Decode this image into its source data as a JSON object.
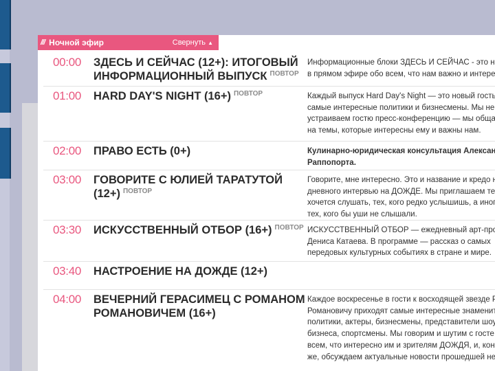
{
  "tab": {
    "icon": "///",
    "title": "Ночной эфир",
    "collapse_label": "Свернуть",
    "collapse_arrow": "▲"
  },
  "repeat_label": "ПОВТОР",
  "schedule": [
    {
      "time": "00:00",
      "title": "ЗДЕСЬ И СЕЙЧАС (12+): ИТОГОВЫЙ ИНФОРМАЦИОННЫЙ ВЫПУСК",
      "repeat": true,
      "desc_bold": false,
      "desc": [
        "Информационные блоки ЗДЕСЬ И СЕЙЧАС - это но",
        "в прямом эфире обо всем, что нам важно и интерес"
      ]
    },
    {
      "time": "01:00",
      "title": "HARD DAY'S NIGHT (16+)",
      "repeat": true,
      "desc_bold": false,
      "desc": [
        " Каждый выпуск Hard Day's Night — это новый гость",
        "самые интересные политики и бизнесмены. Мы не т",
        "устраиваем гостю пресс-конференцию — мы общае",
        "на темы, которые интересны ему и важны нам."
      ]
    },
    {
      "time": "02:00",
      "title": "ПРАВО ЕСТЬ (0+)",
      "repeat": false,
      "desc_bold": true,
      "desc": [
        "Кулинарно-юридическая консультация Алексан",
        "Раппопорта."
      ]
    },
    {
      "time": "03:00",
      "title": "ГОВОРИТЕ С ЮЛИЕЙ ТАРАТУТОЙ (12+)",
      "repeat": true,
      "desc_bold": false,
      "desc": [
        "Говорите, мне интересно. Это и название и кредо н",
        "дневного интервью на ДОЖДЕ. Мы приглашаем тех",
        "хочется слушать, тех, кого редко услышишь, а иногд",
        "тех, кого бы уши не слышали."
      ]
    },
    {
      "time": "03:30",
      "title": "ИСКУССТВЕННЫЙ ОТБОР (16+)",
      "repeat": true,
      "desc_bold": false,
      "desc": [
        "ИСКУССТВЕННЫЙ ОТБОР — ежедневный арт-про",
        "Дениса Катаева. В программе — рассказ о самых",
        "передовых культурных событиях в стране и мире."
      ]
    },
    {
      "time": "03:40",
      "title": "НАСТРОЕНИЕ НА ДОЖДЕ (12+)",
      "repeat": false,
      "desc_bold": false,
      "desc": []
    },
    {
      "time": "04:00",
      "title": "ВЕЧЕРНИЙ ГЕРАСИМЕЦ С РОМАНОМ РОМАНОВИЧЕМ (16+)",
      "repeat": false,
      "desc_bold": false,
      "desc": [
        "Каждое воскресенье в гости к восходящей звезде Р",
        "Романовичу приходят самые интересные знаменит",
        "политики, актеры, бизнесмены, представители шоу",
        "бизнеса, спортсмены. Мы говорим и шутим с госте",
        "всем, что интересно им и зрителям ДОЖДЯ, и, коне",
        "же, обсуждаем актуальные новости прошедшей не"
      ]
    }
  ]
}
